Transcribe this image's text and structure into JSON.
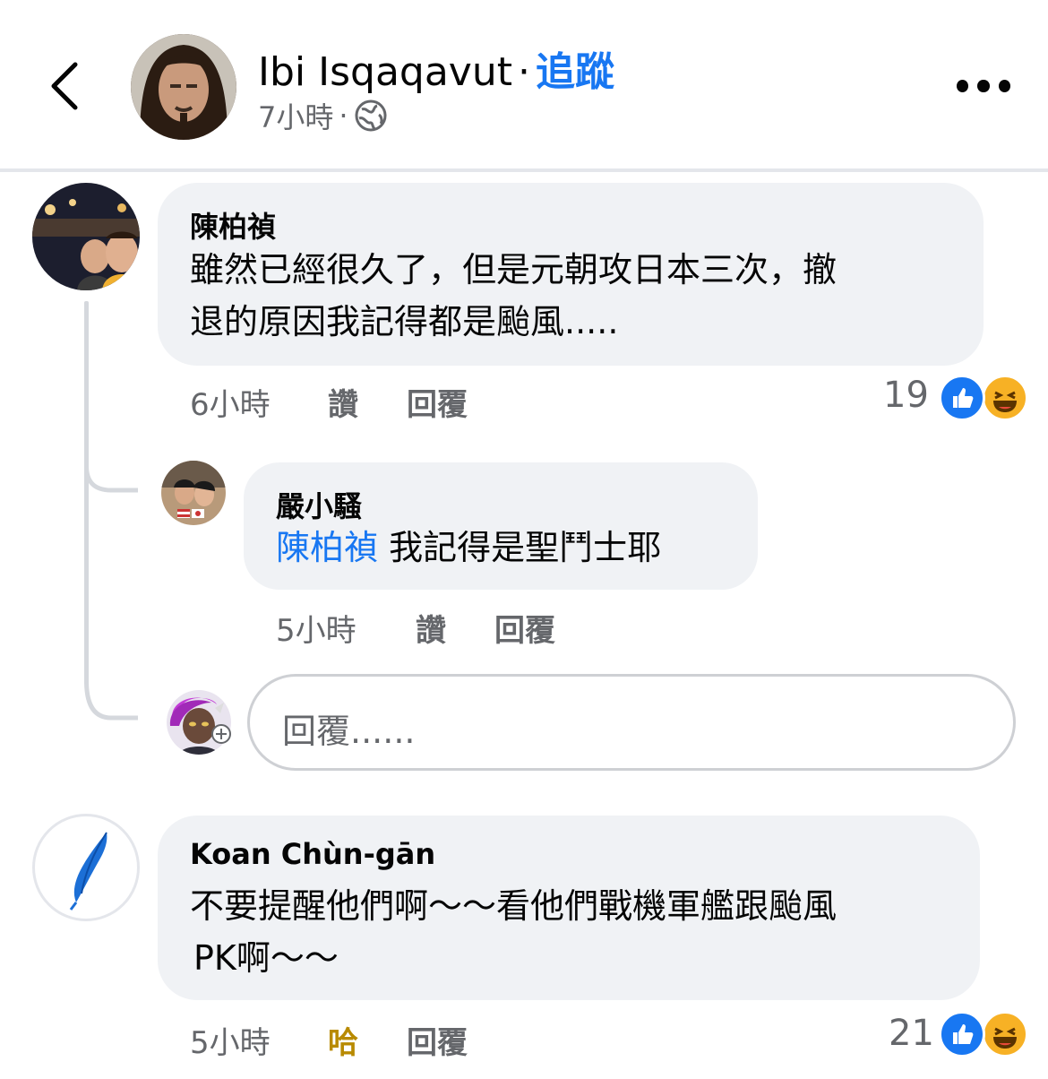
{
  "header": {
    "name": "Ibi Isqaqavut",
    "separator": "·",
    "follow": "追蹤",
    "time": "7小時",
    "meta_dot": "·",
    "privacy_icon": "globe-icon"
  },
  "comments": [
    {
      "author": "陳柏禎",
      "text_line1": "雖然已經很久了，但是元朝攻日本三次，撤",
      "text_line2": "退的原因我記得都是颱風.....",
      "time": "6小時",
      "like": "讚",
      "reply": "回覆",
      "reaction_count": "19",
      "reactions": [
        "like-icon",
        "haha-icon"
      ],
      "replies": [
        {
          "author": "嚴小騷",
          "mention": "陳柏禎",
          "text": "我記得是聖鬥士耶",
          "time": "5小時",
          "like": "讚",
          "reply": "回覆"
        }
      ],
      "reply_input_placeholder": "回覆......"
    },
    {
      "author": "Koan Chùn-gān",
      "text_line1": "不要提醒他們啊～～看他們戰機軍艦跟颱風",
      "text_line2": "PK啊～～",
      "time": "5小時",
      "like": "哈",
      "reply": "回覆",
      "reaction_count": "21",
      "reactions": [
        "like-icon",
        "haha-icon"
      ]
    }
  ],
  "colors": {
    "accent": "#1877f2",
    "bubble": "#f0f2f5",
    "muted": "#65676b",
    "haha": "#f7b125"
  }
}
